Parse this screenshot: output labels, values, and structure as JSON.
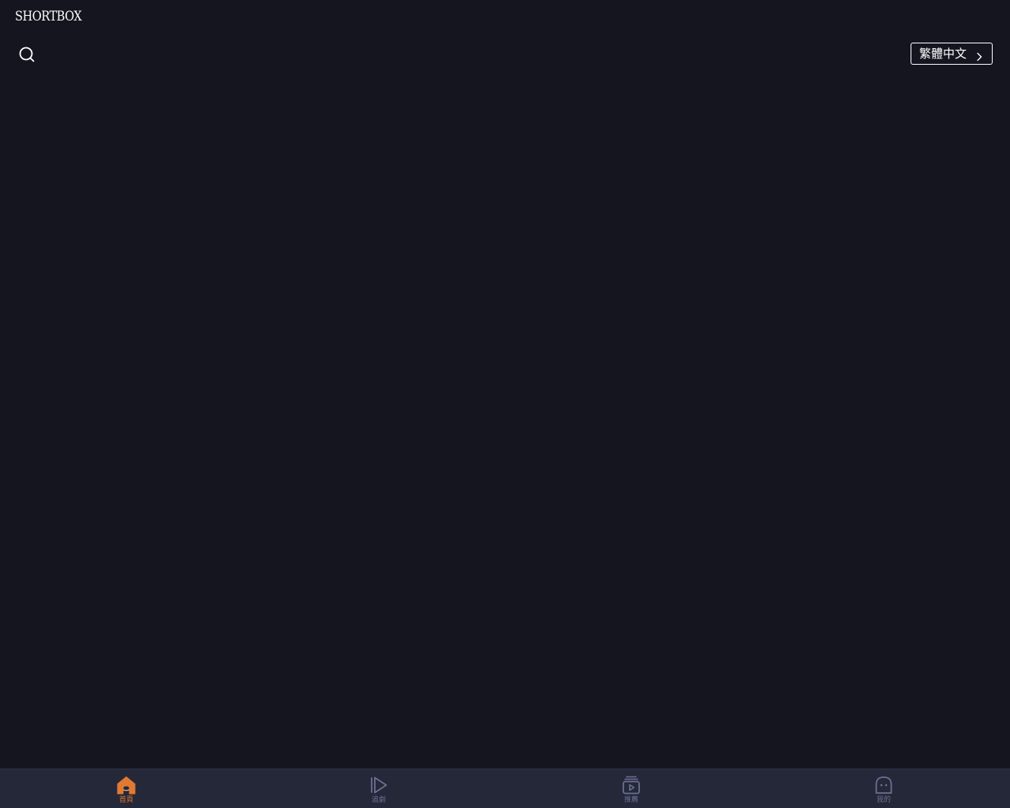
{
  "header": {
    "logo_text": "SHORTBOX",
    "language_label": "繁體中文"
  },
  "tabbar": {
    "tabs": [
      {
        "label": "首頁",
        "icon": "home-icon",
        "active": true
      },
      {
        "label": "追劇",
        "icon": "play-icon",
        "active": false
      },
      {
        "label": "推薦",
        "icon": "video-stack-icon",
        "active": false
      },
      {
        "label": "我的",
        "icon": "ghost-profile-icon",
        "active": false
      }
    ]
  },
  "colors": {
    "background": "#151520",
    "tabbar_background": "#252838",
    "accent": "#e07a33",
    "inactive_tab": "#6c6f93",
    "text": "#ffffff"
  }
}
